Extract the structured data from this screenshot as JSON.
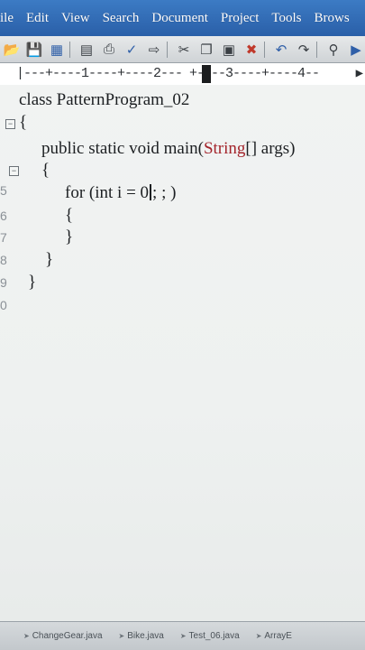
{
  "menubar": {
    "items": [
      "ile",
      "Edit",
      "View",
      "Search",
      "Document",
      "Project",
      "Tools",
      "Brows"
    ]
  },
  "toolbar": {
    "icons": [
      "open-icon",
      "save-icon",
      "save-all-icon",
      "print-preview-icon",
      "print-icon",
      "spell-check-icon",
      "export-icon",
      "cut-icon",
      "copy-icon",
      "paste-icon",
      "delete-icon",
      "undo-icon",
      "redo-icon",
      "find-icon",
      "find-next-icon"
    ]
  },
  "ruler": {
    "text": "|---+----1----+----2---  +----3----+----4--"
  },
  "editor": {
    "gutter": [
      "",
      "",
      "",
      "",
      "5",
      "6",
      "7",
      "8",
      "9",
      "0"
    ],
    "lines": {
      "l1": "class PatternProgram_02",
      "l2": "{",
      "l3a": "public static void main(",
      "l3b": "String",
      "l3c": "[] args)",
      "l4": "{",
      "l5a": "for (int i = 0",
      "l5b": "; ; )",
      "l6": "{",
      "l7": "}",
      "l8": "}",
      "l9": "}"
    }
  },
  "tabs": [
    "ChangeGear.java",
    "Bike.java",
    "Test_06.java",
    "ArrayE"
  ],
  "colors": {
    "menubar": "#2a5fa8",
    "keyword_red": "#a3242b",
    "text": "#1c1f22"
  }
}
